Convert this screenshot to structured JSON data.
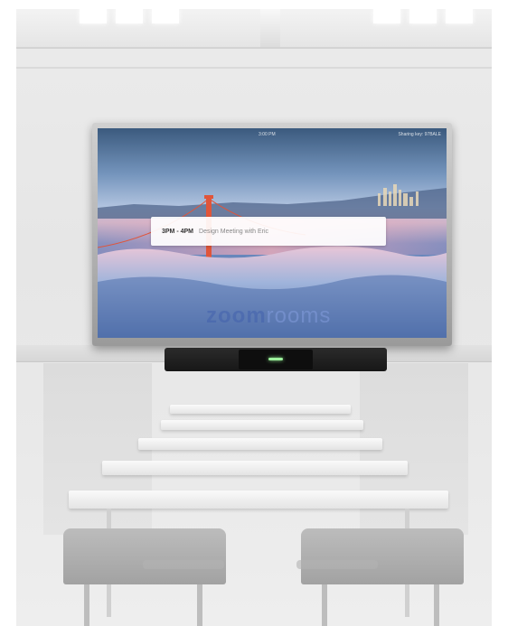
{
  "tv": {
    "top_left": "",
    "time": "3:00 PM",
    "top_right": "Sharing key: 97BALE"
  },
  "meeting": {
    "time": "3PM - 4PM",
    "title": "Design Meeting with Eric"
  },
  "brand": {
    "name_bold": "zoom",
    "name_light": "rooms"
  },
  "colors": {
    "wall": "#e8e8e8",
    "screen_sky": "#7595bd",
    "bridge": "#e0553a",
    "camera_light": "#9df29d",
    "soundbar": "#1f1f1f"
  }
}
